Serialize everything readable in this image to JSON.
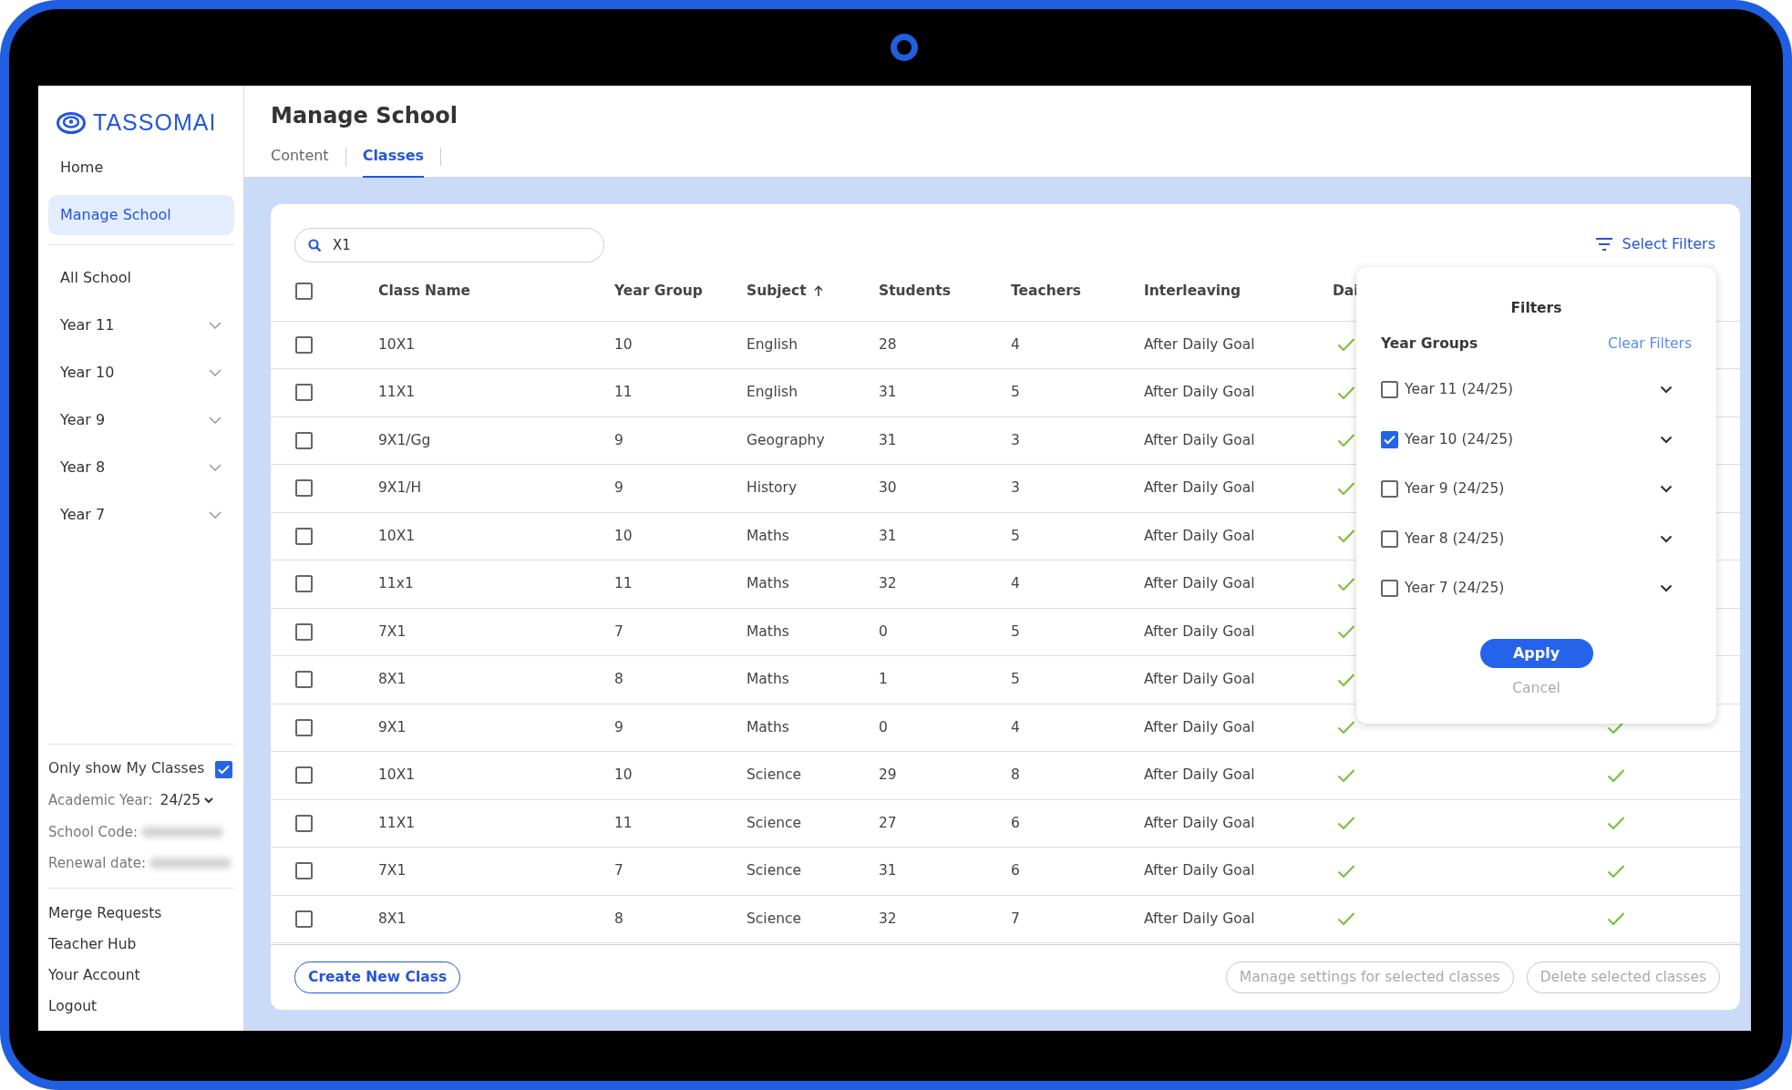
{
  "logo": {
    "text": "TASSOMAI"
  },
  "sidebar": {
    "items": [
      {
        "label": "Home",
        "selected": false,
        "expandable": false
      },
      {
        "label": "Manage School",
        "selected": true,
        "expandable": false
      }
    ],
    "year_items": [
      {
        "label": "All School",
        "expandable": false
      },
      {
        "label": "Year 11",
        "expandable": true
      },
      {
        "label": "Year 10",
        "expandable": true
      },
      {
        "label": "Year 9",
        "expandable": true
      },
      {
        "label": "Year 8",
        "expandable": true
      },
      {
        "label": "Year 7",
        "expandable": true
      }
    ],
    "only_my_classes": {
      "label": "Only show My Classes",
      "checked": true
    },
    "academic_year": {
      "label": "Academic Year:",
      "value": "24/25"
    },
    "school_code": {
      "label": "School Code:",
      "redacted": true
    },
    "renewal_date": {
      "label": "Renewal date:",
      "redacted": true
    },
    "links": [
      "Merge Requests",
      "Teacher Hub",
      "Your Account",
      "Logout"
    ]
  },
  "page": {
    "title": "Manage School",
    "tabs": [
      {
        "label": "Content",
        "selected": false
      },
      {
        "label": "Classes",
        "selected": true
      }
    ]
  },
  "search": {
    "value": "X1"
  },
  "select_filters": "Select Filters",
  "table": {
    "select_all": false,
    "columns": [
      {
        "label": "Class Name"
      },
      {
        "label": "Year Group"
      },
      {
        "label": "Subject",
        "sorted_ascending": true
      },
      {
        "label": "Students"
      },
      {
        "label": "Teachers"
      },
      {
        "label": "Interleaving"
      },
      {
        "label": "Dai"
      }
    ],
    "rows": [
      {
        "selected": false,
        "cells": [
          "10X1",
          "10",
          "English",
          "28",
          "4",
          "After Daily Goal"
        ],
        "daily_goal": true
      },
      {
        "selected": false,
        "cells": [
          "11X1",
          "11",
          "English",
          "31",
          "5",
          "After Daily Goal"
        ],
        "daily_goal": true
      },
      {
        "selected": false,
        "cells": [
          "9X1/Gg",
          "9",
          "Geography",
          "31",
          "3",
          "After Daily Goal"
        ],
        "daily_goal": true
      },
      {
        "selected": false,
        "cells": [
          "9X1/H",
          "9",
          "History",
          "30",
          "3",
          "After Daily Goal"
        ],
        "daily_goal": true
      },
      {
        "selected": false,
        "cells": [
          "10X1",
          "10",
          "Maths",
          "31",
          "5",
          "After Daily Goal"
        ],
        "daily_goal": true
      },
      {
        "selected": false,
        "cells": [
          "11x1",
          "11",
          "Maths",
          "32",
          "4",
          "After Daily Goal"
        ],
        "daily_goal": true
      },
      {
        "selected": false,
        "cells": [
          "7X1",
          "7",
          "Maths",
          "0",
          "5",
          "After Daily Goal"
        ],
        "daily_goal": true
      },
      {
        "selected": false,
        "cells": [
          "8X1",
          "8",
          "Maths",
          "1",
          "5",
          "After Daily Goal"
        ],
        "daily_goal": true
      },
      {
        "selected": false,
        "cells": [
          "9X1",
          "9",
          "Maths",
          "0",
          "4",
          "After Daily Goal"
        ],
        "daily_goal": true,
        "column_9": true
      },
      {
        "selected": false,
        "cells": [
          "10X1",
          "10",
          "Science",
          "29",
          "8",
          "After Daily Goal"
        ],
        "daily_goal": true,
        "column_9": true
      },
      {
        "selected": false,
        "cells": [
          "11X1",
          "11",
          "Science",
          "27",
          "6",
          "After Daily Goal"
        ],
        "daily_goal": true,
        "column_9": true
      },
      {
        "selected": false,
        "cells": [
          "7X1",
          "7",
          "Science",
          "31",
          "6",
          "After Daily Goal"
        ],
        "daily_goal": true,
        "column_9": true
      },
      {
        "selected": false,
        "cells": [
          "8X1",
          "8",
          "Science",
          "32",
          "7",
          "After Daily Goal"
        ],
        "daily_goal": true,
        "column_9": true
      }
    ]
  },
  "footer": {
    "create": "Create New Class",
    "actions": [
      {
        "label": "Manage settings for selected classes",
        "disabled": true
      },
      {
        "label": "Delete selected classes",
        "disabled": true
      }
    ]
  },
  "filters": {
    "title": "Filters",
    "section": "Year Groups",
    "clear": "Clear Filters",
    "options": [
      {
        "label": "Year 11 (24/25)",
        "checked": false
      },
      {
        "label": "Year 10 (24/25)",
        "checked": true
      },
      {
        "label": "Year 9 (24/25)",
        "checked": false
      },
      {
        "label": "Year 8 (24/25)",
        "checked": false
      },
      {
        "label": "Year 7 (24/25)",
        "checked": false
      }
    ],
    "apply": "Apply",
    "cancel": "Cancel"
  }
}
